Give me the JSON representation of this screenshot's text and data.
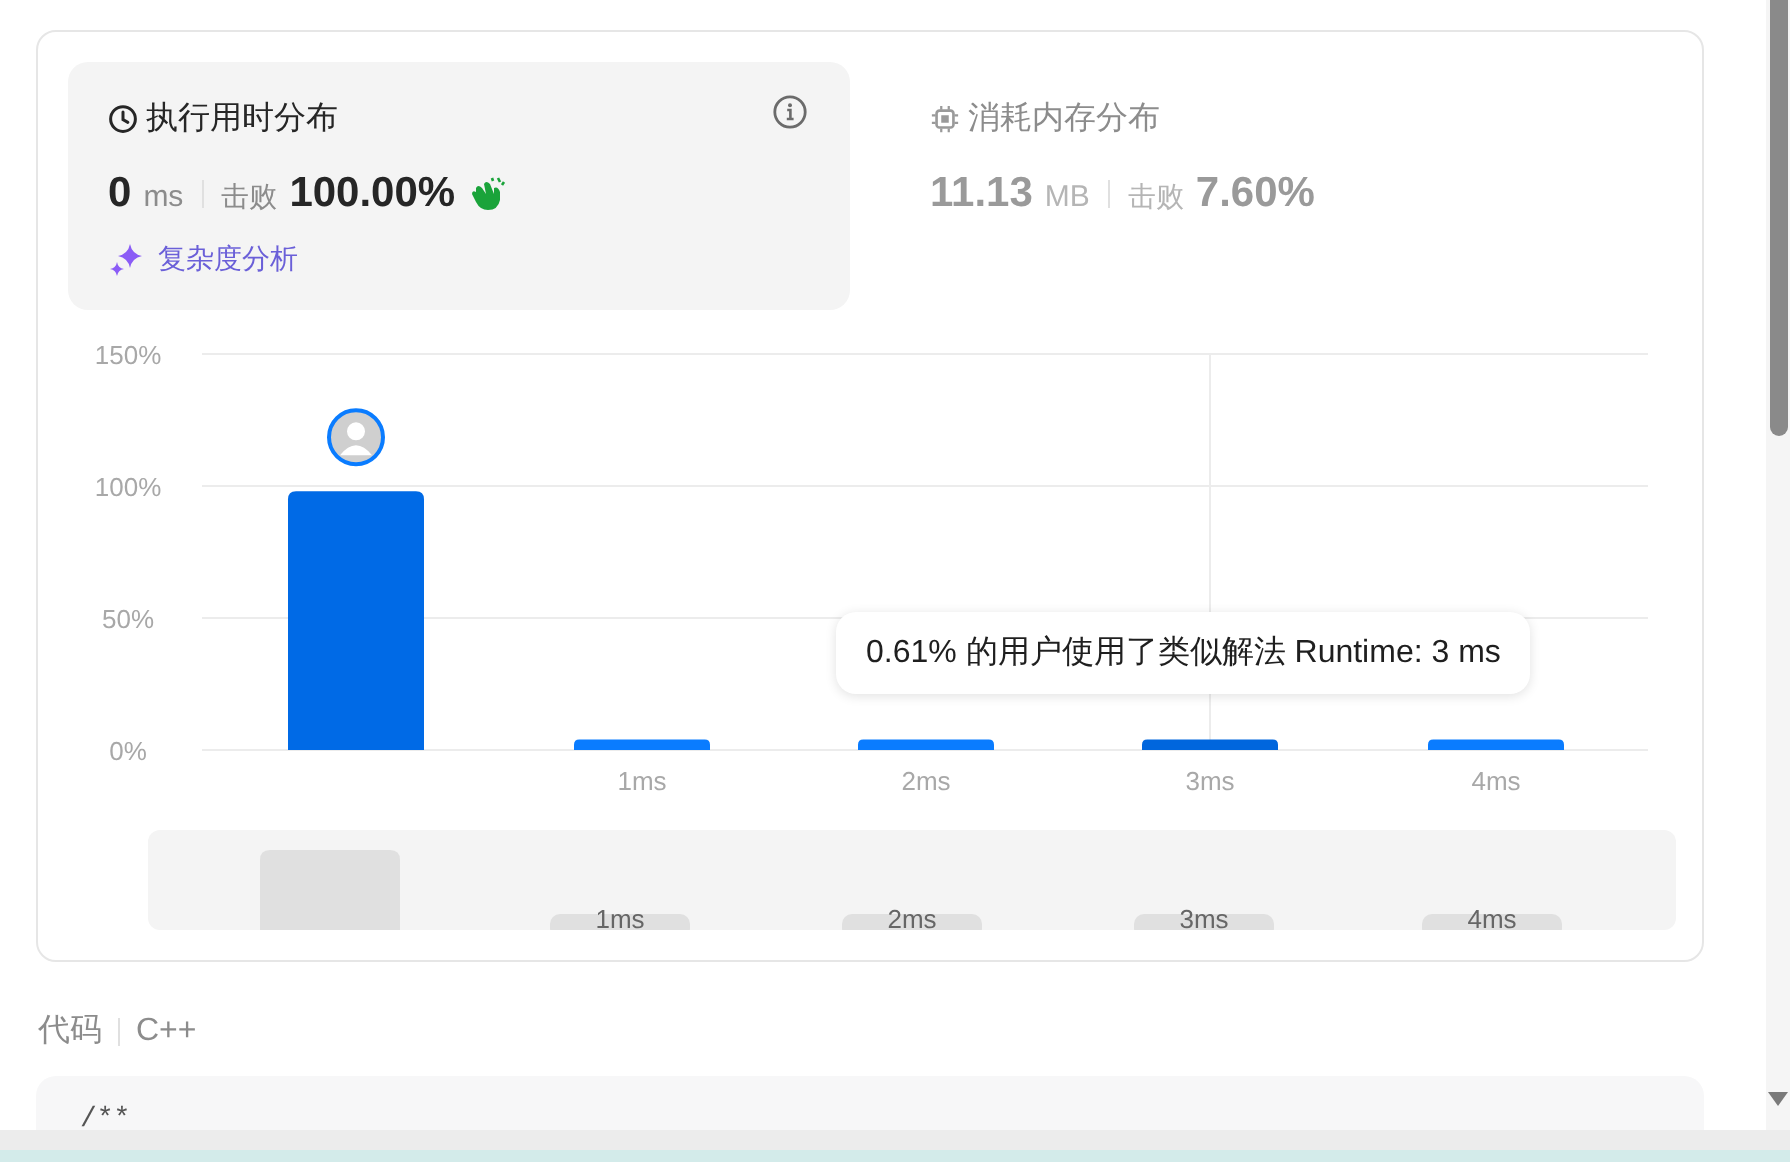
{
  "metrics": [
    {
      "kind": "runtime",
      "title": "执行用时分布",
      "value": "0",
      "unit": "ms",
      "beats_label": "击败",
      "beats": "100.00%",
      "link": "复杂度分析",
      "selected": true
    },
    {
      "kind": "memory",
      "title": "消耗内存分布",
      "value": "11.13",
      "unit": "MB",
      "beats_label": "击败",
      "beats": "7.60%",
      "selected": false
    }
  ],
  "chart": {
    "chart_data": {
      "type": "bar",
      "categories": [
        null,
        "1ms",
        "2ms",
        "3ms",
        "4ms"
      ],
      "values": [
        98,
        4,
        4,
        4,
        4
      ],
      "grid": true,
      "ylim": [
        0,
        150
      ],
      "yticks": [
        {
          "value": 0,
          "label": "0%"
        },
        {
          "value": 50,
          "label": "50%"
        },
        {
          "value": 100,
          "label": "100%"
        },
        {
          "value": 150,
          "label": "150%"
        }
      ]
    },
    "bars": [
      {
        "hovered": false,
        "mine": true
      },
      {
        "hovered": false,
        "mine": false
      },
      {
        "hovered": false,
        "mine": false
      },
      {
        "hovered": true,
        "mine": false
      },
      {
        "hovered": false,
        "mine": false
      }
    ],
    "tooltip": "0.61% 的用户使用了类似解法 Runtime: 3 ms",
    "navigator_labels": [
      "1ms",
      "2ms",
      "3ms",
      "4ms"
    ]
  },
  "code": {
    "label": "代码",
    "language": "C++",
    "first_line": "/**"
  }
}
